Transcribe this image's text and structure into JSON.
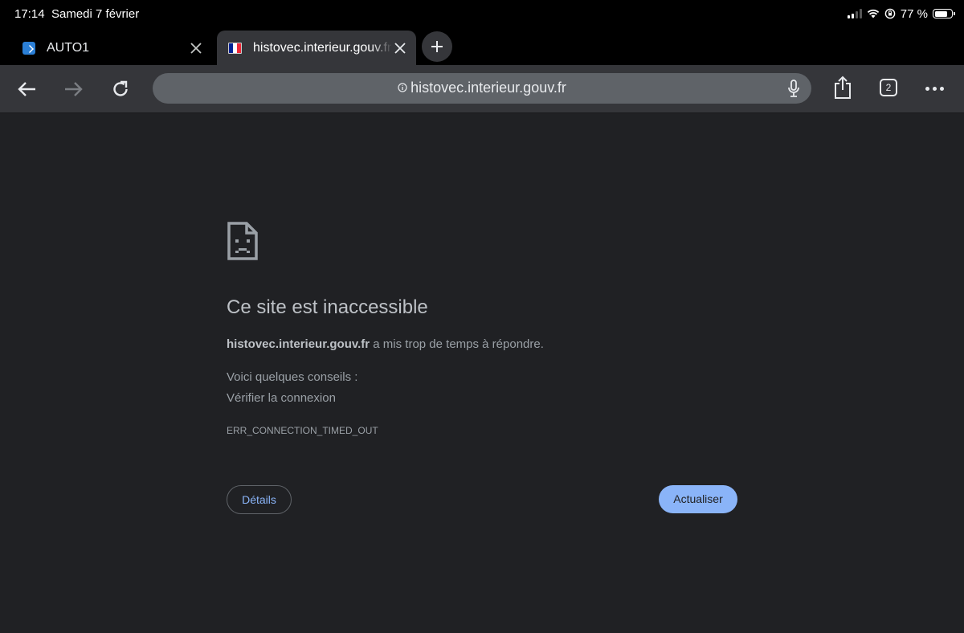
{
  "status_bar": {
    "time": "17:14",
    "date": "Samedi 7 février",
    "battery": "77 %",
    "battery_level": 0.77,
    "signal_bars": 2
  },
  "tabs": [
    {
      "title": "AUTO1",
      "favicon": "auto1-favicon",
      "active": false
    },
    {
      "title": "histovec.interieur.gouv.fr",
      "favicon": "gouv-favicon",
      "active": true
    }
  ],
  "toolbar": {
    "url": "histovec.interieur.gouv.fr",
    "tab_count": "2"
  },
  "error_page": {
    "title": "Ce site est inaccessible",
    "host": "histovec.interieur.gouv.fr",
    "message": " a mis trop de temps à répondre.",
    "tips_heading": "Voici quelques conseils :",
    "tips": [
      "Vérifier la connexion"
    ],
    "code": "ERR_CONNECTION_TIMED_OUT",
    "details_button": "Détails",
    "reload_button": "Actualiser"
  },
  "colors": {
    "page_bg": "#202124",
    "toolbar_bg": "#35363a",
    "omnibox_bg": "#5f6368",
    "accent": "#8ab4f8"
  }
}
